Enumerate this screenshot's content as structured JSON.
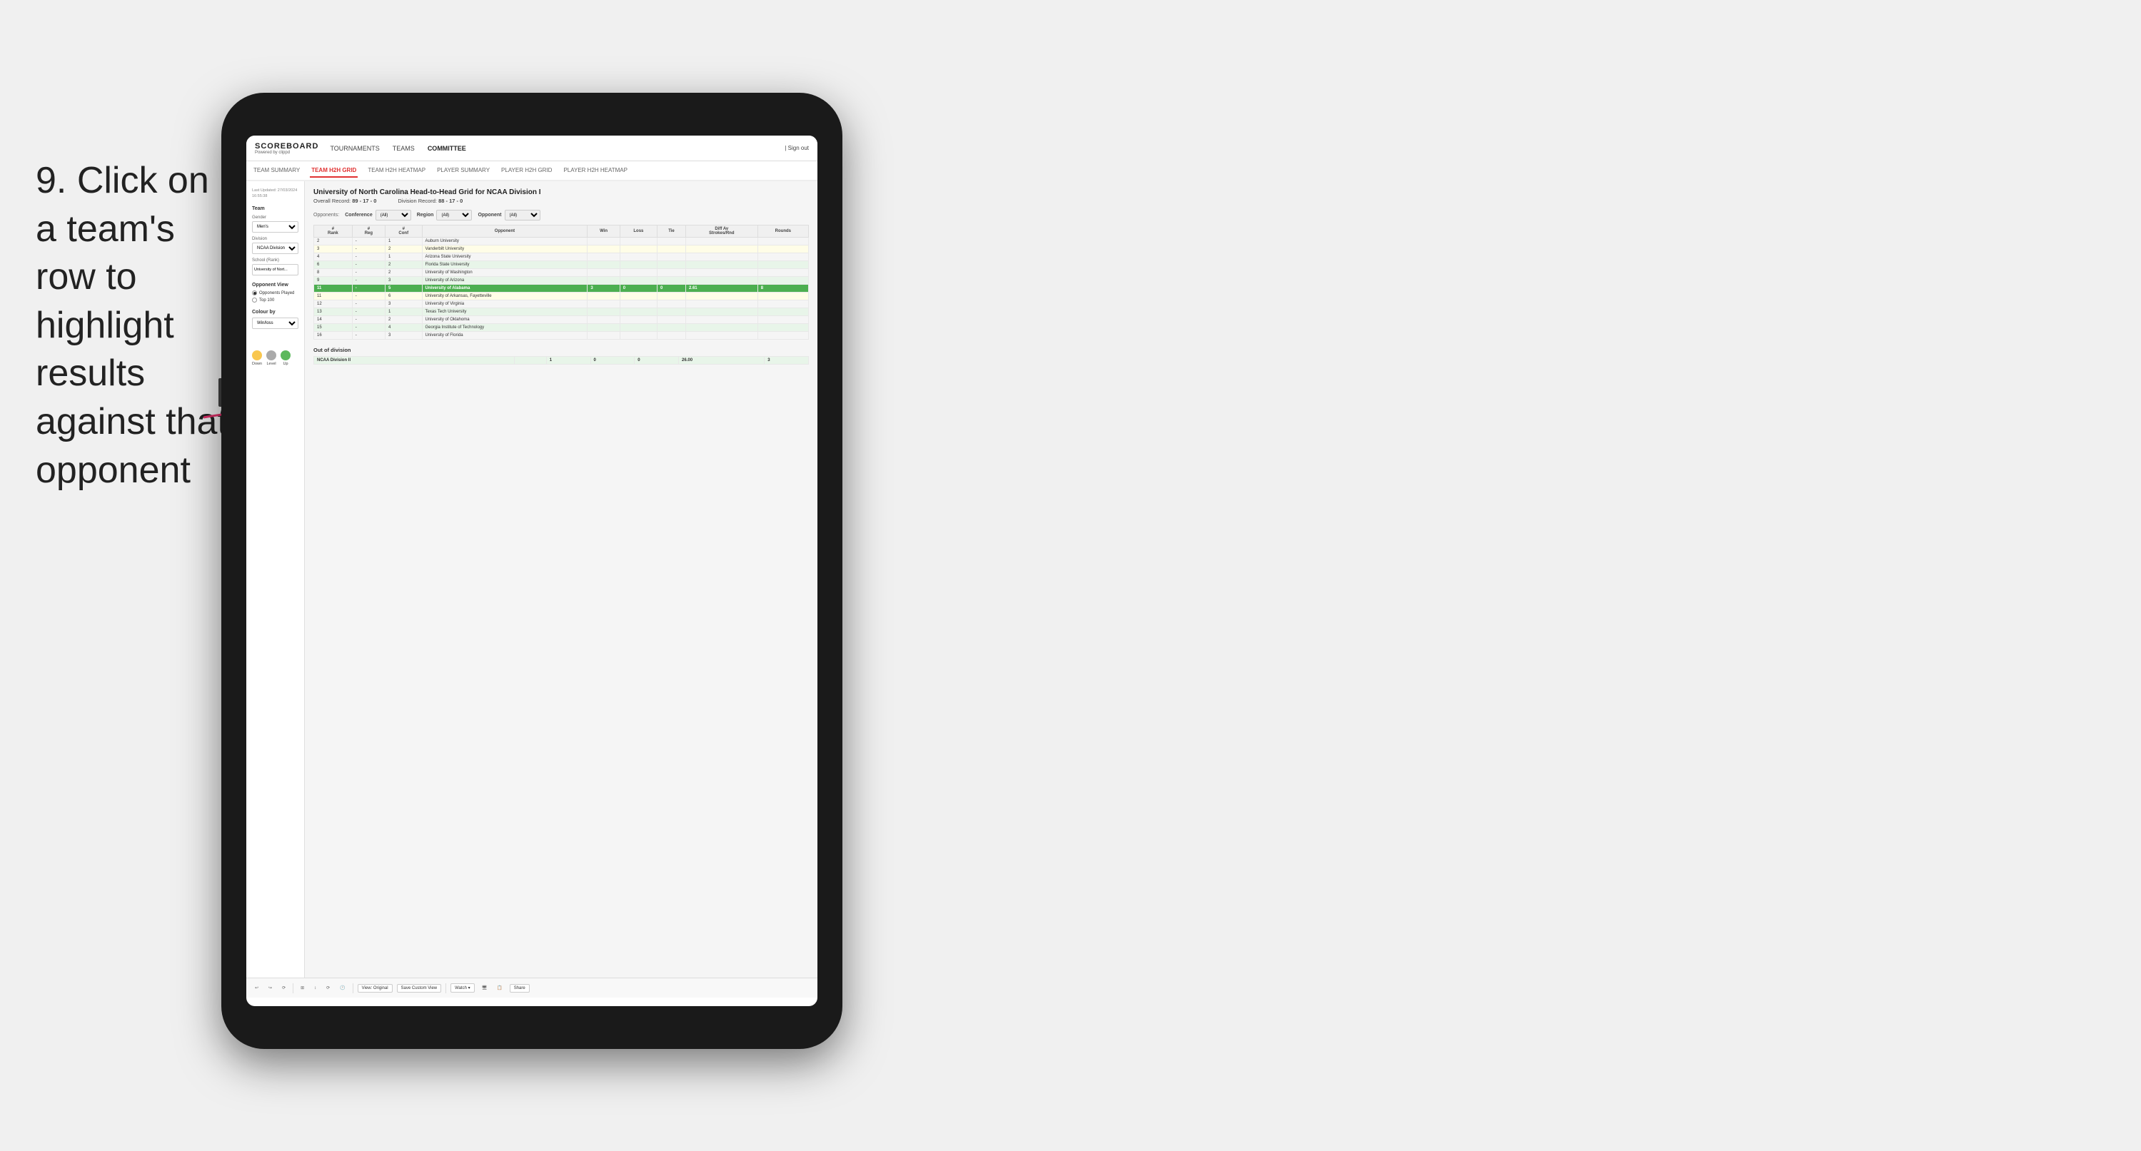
{
  "instruction": {
    "step": "9.",
    "text": "Click on a team's row to highlight results against that opponent"
  },
  "nav": {
    "logo": "SCOREBOARD",
    "logo_sub": "Powered by clippd",
    "links": [
      "TOURNAMENTS",
      "TEAMS",
      "COMMITTEE"
    ],
    "sign_out": "| Sign out"
  },
  "sub_nav": {
    "items": [
      "TEAM SUMMARY",
      "TEAM H2H GRID",
      "TEAM H2H HEATMAP",
      "PLAYER SUMMARY",
      "PLAYER H2H GRID",
      "PLAYER H2H HEATMAP"
    ],
    "active": "TEAM H2H GRID"
  },
  "sidebar": {
    "timestamp_label": "Last Updated: 27/03/2024",
    "timestamp_time": "16:55:38",
    "team_label": "Team",
    "gender_label": "Gender",
    "gender_value": "Men's",
    "division_label": "Division",
    "division_value": "NCAA Division I",
    "school_label": "School (Rank)",
    "school_value": "University of Nort...",
    "opponent_view_label": "Opponent View",
    "radio_options": [
      "Opponents Played",
      "Top 100"
    ],
    "radio_selected": "Opponents Played",
    "colour_by_label": "Colour by",
    "colour_by_value": "Win/loss",
    "legend_items": [
      {
        "label": "Down",
        "color": "#f9c74f"
      },
      {
        "label": "Level",
        "color": "#aaa"
      },
      {
        "label": "Up",
        "color": "#5cb85c"
      }
    ]
  },
  "main": {
    "title": "University of North Carolina Head-to-Head Grid for NCAA Division I",
    "overall_record_label": "Overall Record:",
    "overall_record": "89 - 17 - 0",
    "division_record_label": "Division Record:",
    "division_record": "88 - 17 - 0",
    "filters": {
      "opponents_label": "Opponents:",
      "conference_label": "Conference",
      "conference_value": "(All)",
      "region_label": "Region",
      "region_value": "(All)",
      "opponent_label": "Opponent",
      "opponent_value": "(All)"
    },
    "table_headers": [
      "#\nRank",
      "#\nReg",
      "#\nConf",
      "Opponent",
      "Win",
      "Loss",
      "Tie",
      "Diff Av\nStrokes/Rnd",
      "Rounds"
    ],
    "rows": [
      {
        "rank": "2",
        "reg": "-",
        "conf": "1",
        "opponent": "Auburn University",
        "win": "",
        "loss": "",
        "tie": "",
        "diff": "",
        "rounds": "",
        "style": "normal"
      },
      {
        "rank": "3",
        "reg": "-",
        "conf": "2",
        "opponent": "Vanderbilt University",
        "win": "",
        "loss": "",
        "tie": "",
        "diff": "",
        "rounds": "",
        "style": "light-yellow"
      },
      {
        "rank": "4",
        "reg": "-",
        "conf": "1",
        "opponent": "Arizona State University",
        "win": "",
        "loss": "",
        "tie": "",
        "diff": "",
        "rounds": "",
        "style": "normal"
      },
      {
        "rank": "6",
        "reg": "-",
        "conf": "2",
        "opponent": "Florida State University",
        "win": "",
        "loss": "",
        "tie": "",
        "diff": "",
        "rounds": "",
        "style": "light-green"
      },
      {
        "rank": "8",
        "reg": "-",
        "conf": "2",
        "opponent": "University of Washington",
        "win": "",
        "loss": "",
        "tie": "",
        "diff": "",
        "rounds": "",
        "style": "normal"
      },
      {
        "rank": "9",
        "reg": "-",
        "conf": "3",
        "opponent": "University of Arizona",
        "win": "",
        "loss": "",
        "tie": "",
        "diff": "",
        "rounds": "",
        "style": "light-green"
      },
      {
        "rank": "11",
        "reg": "-",
        "conf": "5",
        "opponent": "University of Alabama",
        "win": "3",
        "loss": "0",
        "tie": "0",
        "diff": "2.61",
        "rounds": "8",
        "style": "highlighted"
      },
      {
        "rank": "11",
        "reg": "-",
        "conf": "6",
        "opponent": "University of Arkansas, Fayetteville",
        "win": "",
        "loss": "",
        "tie": "",
        "diff": "",
        "rounds": "",
        "style": "light-yellow"
      },
      {
        "rank": "12",
        "reg": "-",
        "conf": "3",
        "opponent": "University of Virginia",
        "win": "",
        "loss": "",
        "tie": "",
        "diff": "",
        "rounds": "",
        "style": "normal"
      },
      {
        "rank": "13",
        "reg": "-",
        "conf": "1",
        "opponent": "Texas Tech University",
        "win": "",
        "loss": "",
        "tie": "",
        "diff": "",
        "rounds": "",
        "style": "light-green"
      },
      {
        "rank": "14",
        "reg": "-",
        "conf": "2",
        "opponent": "University of Oklahoma",
        "win": "",
        "loss": "",
        "tie": "",
        "diff": "",
        "rounds": "",
        "style": "normal"
      },
      {
        "rank": "15",
        "reg": "-",
        "conf": "4",
        "opponent": "Georgia Institute of Technology",
        "win": "",
        "loss": "",
        "tie": "",
        "diff": "",
        "rounds": "",
        "style": "light-green"
      },
      {
        "rank": "16",
        "reg": "-",
        "conf": "3",
        "opponent": "University of Florida",
        "win": "",
        "loss": "",
        "tie": "",
        "diff": "",
        "rounds": "",
        "style": "normal"
      }
    ],
    "out_of_division_label": "Out of division",
    "out_of_division_row": {
      "label": "NCAA Division II",
      "win": "1",
      "loss": "0",
      "tie": "0",
      "diff": "26.00",
      "rounds": "3"
    }
  },
  "toolbar": {
    "buttons": [
      "↩",
      "↪",
      "⟳",
      "⊞",
      "↕",
      "⟳",
      "🕐"
    ],
    "view_label": "View: Original",
    "save_custom": "Save Custom View",
    "watch_label": "Watch ▾",
    "share_label": "Share"
  }
}
